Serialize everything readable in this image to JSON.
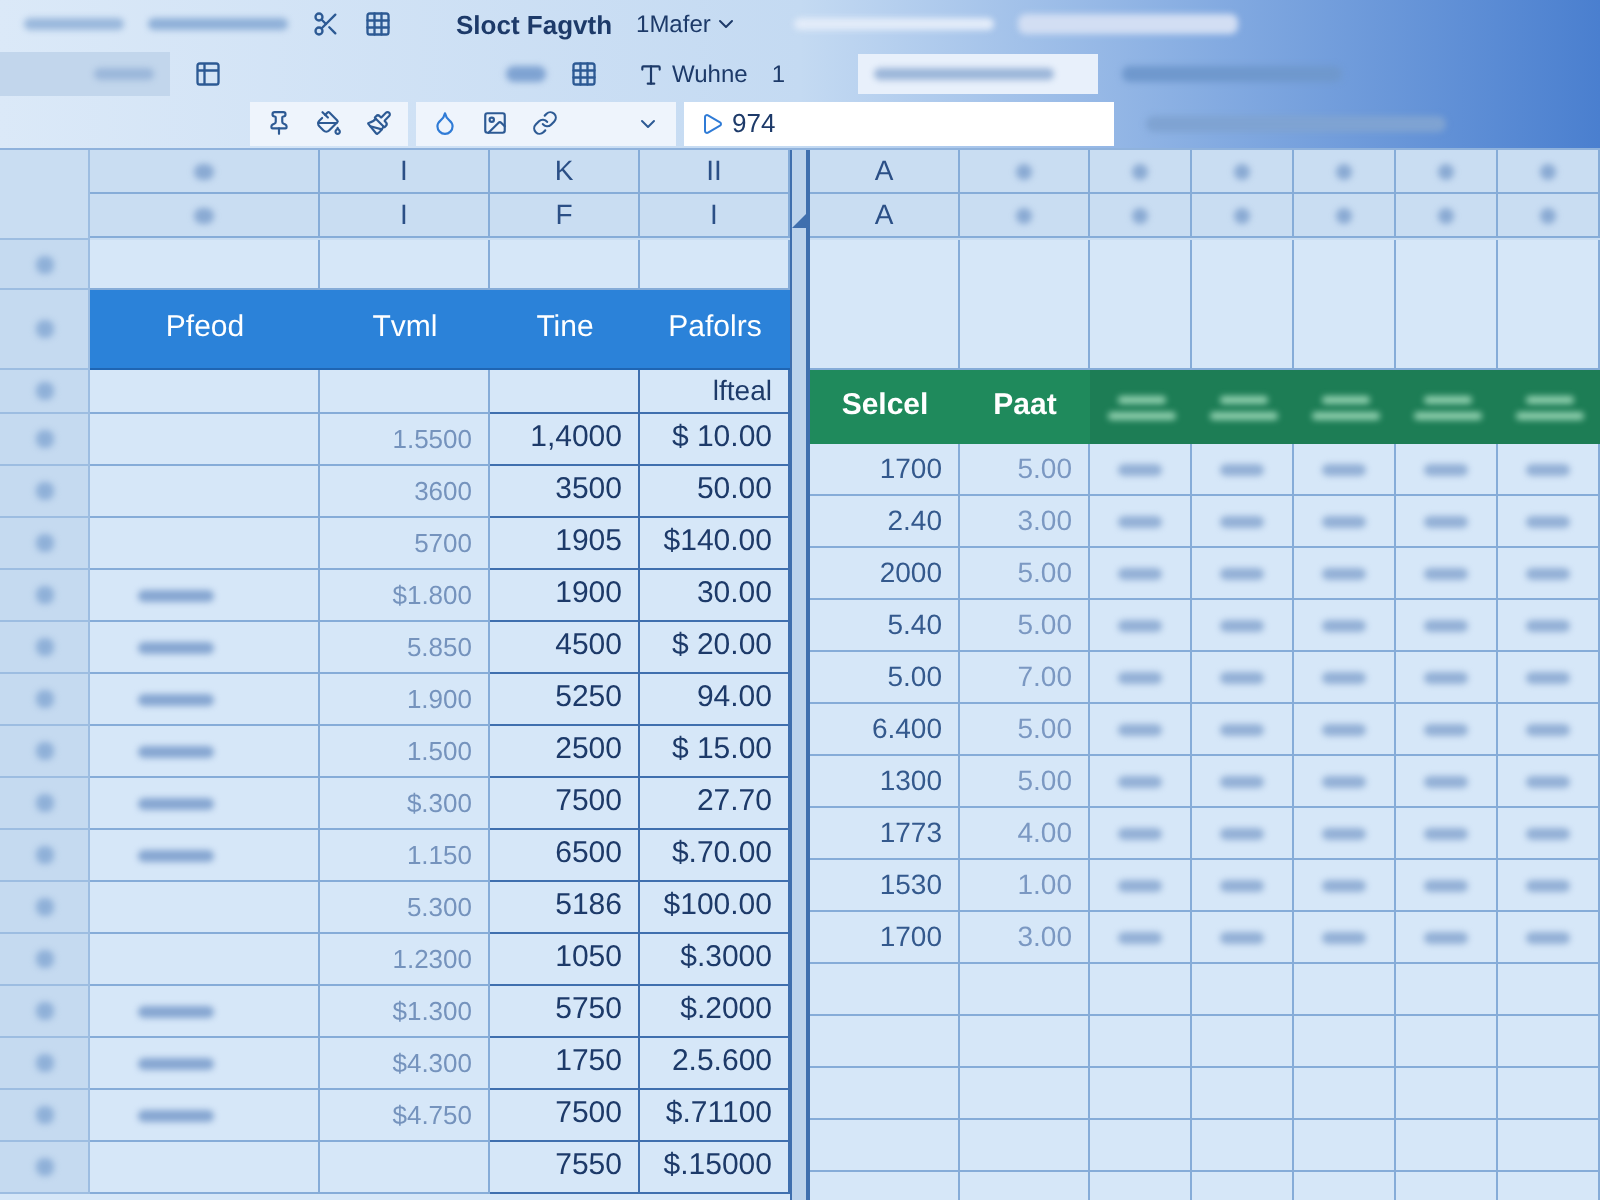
{
  "ribbon": {
    "title_tab": "Sloct Fagvth",
    "menu": "1Mafer",
    "font_label": "Wuhne",
    "size_label": "1",
    "cell_reference": "974"
  },
  "column_letters": {
    "left": [
      {
        "top": "I",
        "bottom": "I"
      },
      {
        "top": "K",
        "bottom": "F"
      },
      {
        "top": "II",
        "bottom": "I"
      }
    ],
    "right": [
      {
        "top": "A",
        "bottom": "A"
      }
    ]
  },
  "left_table": {
    "columns": [
      "Pfeod",
      "Tvml",
      "Tine",
      "Pafolrs"
    ],
    "subheader": "lfteal",
    "rows": [
      {
        "blurred_label": false,
        "cells": [
          "",
          "1.5500",
          "1,4000",
          "$ 10.00"
        ]
      },
      {
        "blurred_label": false,
        "cells": [
          "",
          "3600",
          "3500",
          "50.00"
        ]
      },
      {
        "blurred_label": false,
        "cells": [
          "",
          "5700",
          "1905",
          "$140.00"
        ]
      },
      {
        "blurred_label": true,
        "cells": [
          "",
          "$1.800",
          "1900",
          "30.00"
        ]
      },
      {
        "blurred_label": true,
        "cells": [
          "",
          "5.850",
          "4500",
          "$ 20.00"
        ]
      },
      {
        "blurred_label": true,
        "cells": [
          "",
          "1.900",
          "5250",
          "94.00"
        ]
      },
      {
        "blurred_label": true,
        "cells": [
          "",
          "1.500",
          "2500",
          "$ 15.00"
        ]
      },
      {
        "blurred_label": true,
        "cells": [
          "",
          "$.300",
          "7500",
          "27.70"
        ]
      },
      {
        "blurred_label": true,
        "cells": [
          "",
          "1.150",
          "6500",
          "$.70.00"
        ]
      },
      {
        "blurred_label": false,
        "cells": [
          "",
          "5.300",
          "5186",
          "$100.00"
        ]
      },
      {
        "blurred_label": false,
        "cells": [
          "",
          "1.2300",
          "1050",
          "$.3000"
        ]
      },
      {
        "blurred_label": true,
        "cells": [
          "",
          "$1.300",
          "5750",
          "$.2000"
        ]
      },
      {
        "blurred_label": true,
        "cells": [
          "",
          "$4.300",
          "1750",
          "2.5.600"
        ]
      },
      {
        "blurred_label": true,
        "cells": [
          "",
          "$4.750",
          "7500",
          "$.71100"
        ]
      },
      {
        "blurred_label": false,
        "cells": [
          "",
          "",
          "7550",
          "$.15000"
        ]
      }
    ]
  },
  "right_table": {
    "columns": [
      {
        "kind": "text",
        "label": "Selcel"
      },
      {
        "kind": "text",
        "label": "Paat"
      },
      {
        "kind": "blurred"
      },
      {
        "kind": "blurred"
      },
      {
        "kind": "blurred"
      },
      {
        "kind": "blurred"
      },
      {
        "kind": "blurred"
      }
    ],
    "rows": [
      [
        "1700",
        "5.00"
      ],
      [
        "2.40",
        "3.00"
      ],
      [
        "2000",
        "5.00"
      ],
      [
        "5.40",
        "5.00"
      ],
      [
        "5.00",
        "7.00"
      ],
      [
        "6.400",
        "5.00"
      ],
      [
        "1300",
        "5.00"
      ],
      [
        "1773",
        "4.00"
      ],
      [
        "1530",
        "1.00"
      ],
      [
        "1700",
        "3.00"
      ]
    ]
  }
}
